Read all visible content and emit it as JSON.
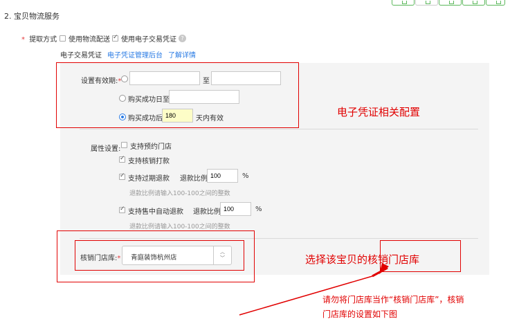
{
  "section": {
    "title": "2. 宝贝物流服务"
  },
  "pickup": {
    "required_mark": "*",
    "label": "提取方式",
    "option_logistics": "使用物流配送",
    "option_voucher": "使用电子交易凭证",
    "help_icon": "help-icon"
  },
  "links": {
    "voucher_text": "电子交易凭证",
    "voucher_admin": "电子凭证管理后台",
    "learn_more": "了解详情"
  },
  "validity": {
    "label": "设置有效期:",
    "required_mark": "*",
    "range_separator": "至",
    "range_start_value": "",
    "range_end_value": "",
    "option_until_date": "购买成功日至",
    "until_date_value": "",
    "option_days_prefix": "购买成功后",
    "days_value": "180",
    "days_suffix": "天内有效"
  },
  "attributes": {
    "label": "属性设置:",
    "appointment_store": "支持预约门店",
    "verify_payment": "支持核销打款",
    "expired_refund": "支持过期退款",
    "refund_ratio_label": "退款比例",
    "expired_refund_ratio": "100",
    "percent": "%",
    "refund_hint": "退款比例请输入100-100之间的整数",
    "auto_refund": "支持售中自动退款",
    "auto_refund_ratio": "100"
  },
  "store": {
    "label": "核销门店库:",
    "required_mark": "*",
    "selected_value": "青庭装饰杭州店"
  },
  "annotations": {
    "voucher_config": "电子凭证相关配置",
    "choose_store": "选择该宝贝的核销门店库",
    "note_line1": "请勿将门店库当作“核销门店库”，核销",
    "note_line2": "门店库的设置如下图"
  },
  "colors": {
    "annotation_red": "#e10000",
    "link_blue": "#2a7be4",
    "panel_bg": "#f4f4f4",
    "top_button_green": "#5cb85c"
  }
}
